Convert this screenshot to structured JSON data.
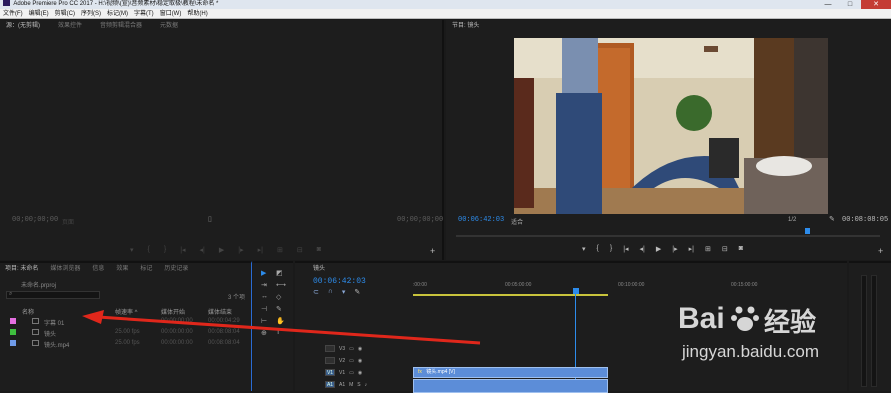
{
  "window": {
    "title": "Adobe Premiere Pro CC 2017 - H:\\视频\\(宣)\\音频素材\\稳定取极\\教程\\未命名 *",
    "controls": [
      "—",
      "□",
      "✕"
    ]
  },
  "menu": {
    "items": [
      "文件(F)",
      "编辑(E)",
      "剪辑(C)",
      "序列(S)",
      "标记(M)",
      "字幕(T)",
      "窗口(W)",
      "帮助(H)"
    ]
  },
  "source_panel": {
    "tabs": [
      "源：(无剪辑)",
      "效果控件",
      "音频剪辑混合器",
      "元数据"
    ],
    "tc_left": "00;00;00;00",
    "tc_right": "00;00;00;00",
    "page": "页面"
  },
  "program_panel": {
    "tab": "节目: 镜头",
    "tc_current": "00:06:42:03",
    "fit": "适合",
    "resolution": "1/2",
    "tc_duration": "00:08:08:05"
  },
  "project_panel": {
    "tabs": [
      "项目: 未命名",
      "媒体浏览器",
      "信息",
      "效果",
      "标记",
      "历史记录"
    ],
    "file": "未命名.prproj",
    "items_count": "3 个项",
    "columns": [
      "名称",
      "帧速率 ^",
      "媒体开始",
      "媒体结束"
    ],
    "rows": [
      {
        "name": "字幕 01",
        "color": "#e36fe0",
        "fps": "",
        "start": "00:00:00:00",
        "end": "00:00:04:29"
      },
      {
        "name": "镜头",
        "color": "#3fbf3f",
        "fps": "25.00 fps",
        "start": "00:00:00:00",
        "end": "00:08:08:04"
      },
      {
        "name": "镜头.mp4",
        "color": "#6f9be8",
        "fps": "25.00 fps",
        "start": "00:00:00:00",
        "end": "00:08:08:04"
      }
    ]
  },
  "timeline": {
    "tab": "镜头",
    "tc": "00:06:42:03",
    "ruler": [
      ":00:00",
      "00:05:00:00",
      "00:10:00:00",
      "00:15:00:00"
    ],
    "tracks": [
      "V3",
      "V2",
      "V1",
      "A1"
    ],
    "clip_v": "镜头.mp4 [V]",
    "fx": "fx"
  },
  "watermark": {
    "brand_left": "Bai",
    "brand_right": "百度",
    "brand_cn": "经验",
    "url": "jingyan.baidu.com"
  },
  "colors": {
    "accent_blue": "#2d8ceb",
    "arrow_red": "#e0271b",
    "timeline_yellow": "#c8c33c",
    "clip_blue": "#5c8dd8"
  }
}
